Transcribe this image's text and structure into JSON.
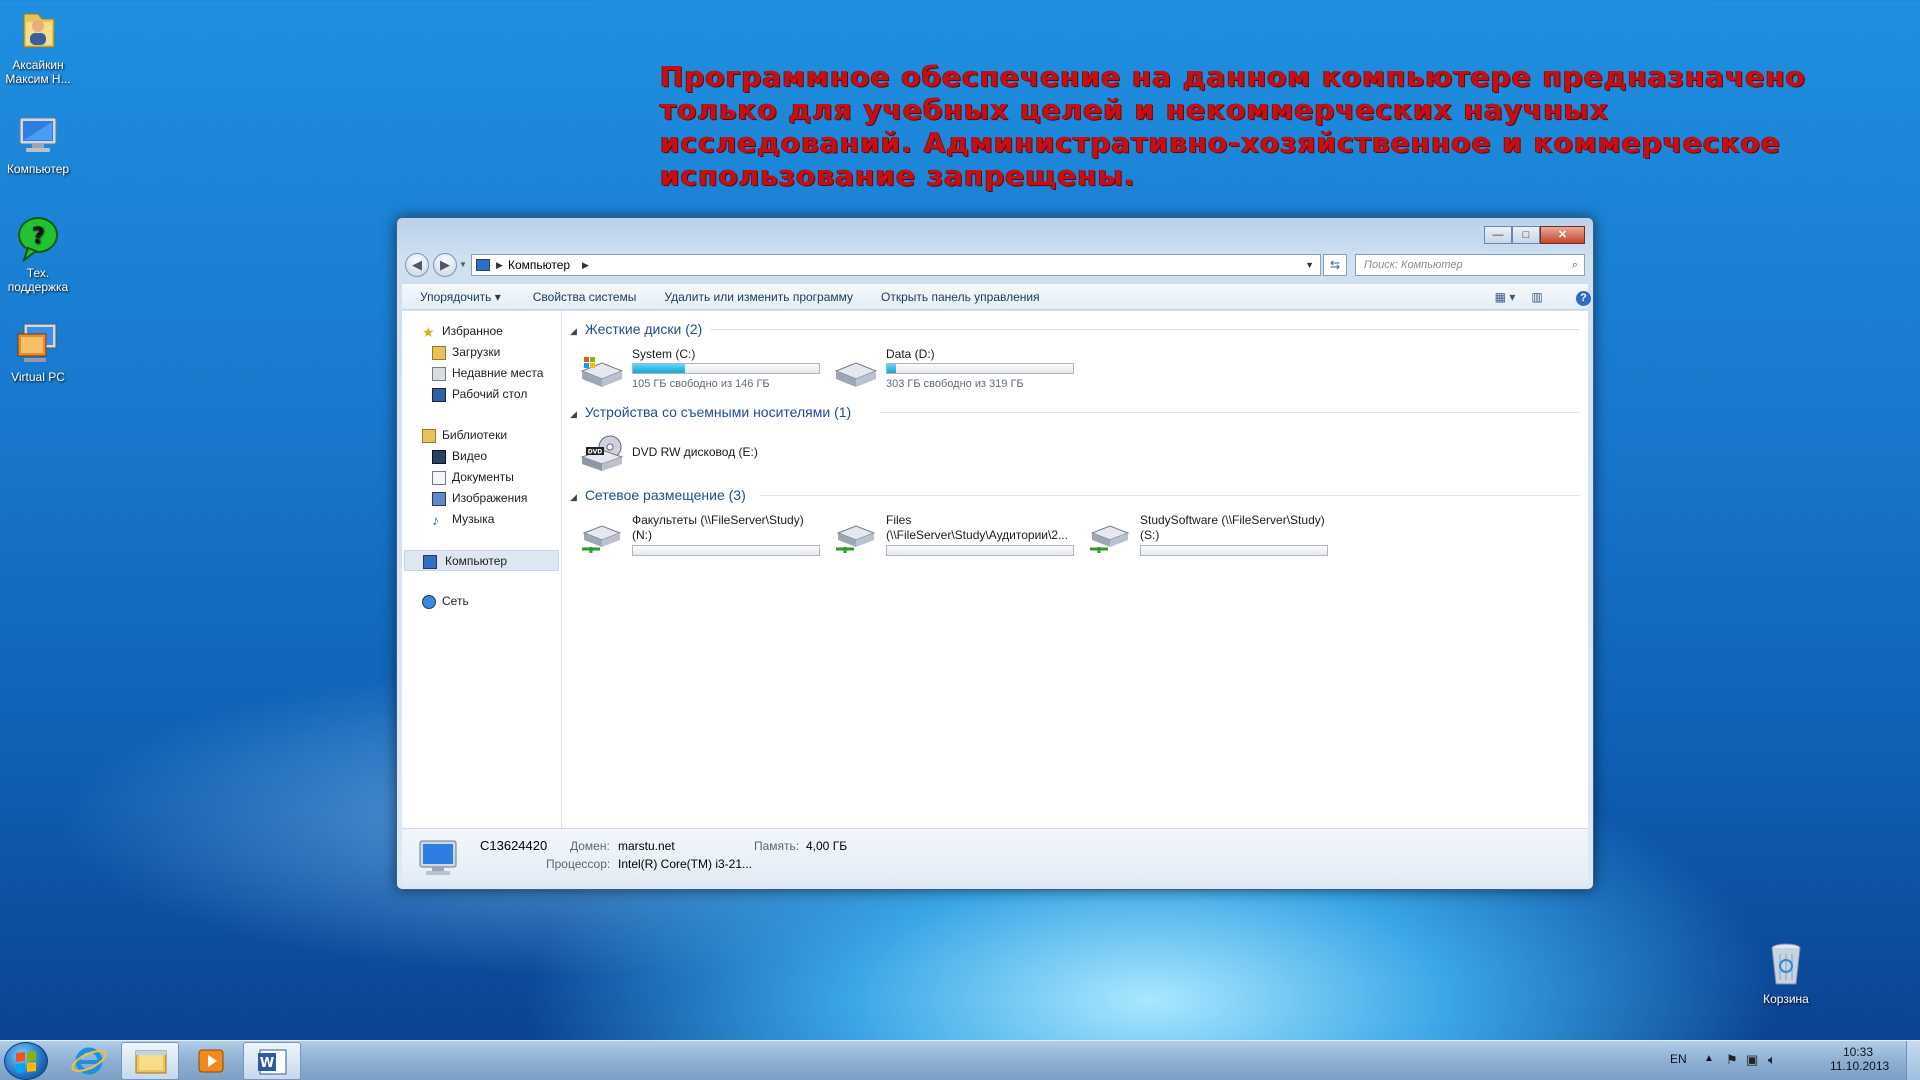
{
  "desktop": {
    "notice_lines": [
      "Программное обеспечение на данном компьютере предназначено",
      "только для учебных целей и некоммерческих научных",
      "исследований.  Административно-хозяйственное и коммерческое",
      "использование запрещены."
    ],
    "icons": [
      {
        "name": "user-folder-icon",
        "label_line1": "Аксайкин",
        "label_line2": "Максим Н..."
      },
      {
        "name": "computer-icon",
        "label_line1": "Компьютер",
        "label_line2": ""
      },
      {
        "name": "help-icon",
        "label_line1": "Тех.",
        "label_line2": "поддержка"
      },
      {
        "name": "virtual-pc-icon",
        "label_line1": "Virtual PC",
        "label_line2": ""
      },
      {
        "name": "recycle-bin-icon",
        "label_line1": "Корзина",
        "label_line2": ""
      }
    ]
  },
  "explorer": {
    "breadcrumb": "Компьютер",
    "search_placeholder": "Поиск: Компьютер",
    "window_buttons": {
      "minimize": "—",
      "maximize": "□",
      "close": "✕"
    },
    "toolbar": {
      "organize": "Упорядочить ▾",
      "system_properties": "Свойства системы",
      "uninstall": "Удалить или изменить программу",
      "control_panel": "Открыть панель управления"
    },
    "sidebar": {
      "favorites": "Избранное",
      "downloads": "Загрузки",
      "recent": "Недавние места",
      "desktop": "Рабочий стол",
      "libraries": "Библиотеки",
      "video": "Видео",
      "documents": "Документы",
      "images": "Изображения",
      "music": "Музыка",
      "computer": "Компьютер",
      "network": "Сеть"
    },
    "groups": {
      "hard_disks": "Жесткие диски (2)",
      "removable": "Устройства со съемными носителями (1)",
      "network": "Сетевое размещение (3)"
    },
    "drives": {
      "c_name": "System (C:)",
      "c_sub": "105 ГБ свободно из 146 ГБ",
      "c_used_fraction": 0.28,
      "d_name": "Data (D:)",
      "d_sub": "303 ГБ свободно из 319 ГБ",
      "d_used_fraction": 0.05,
      "e_name": "DVD RW дисковод (E:)",
      "n_line1": "Факультеты (\\\\FileServer\\Study)",
      "n_line2": "(N:)",
      "f_line1": "Files",
      "f_line2": "(\\\\FileServer\\Study\\Аудитории\\2...",
      "s_line1": "StudySoftware (\\\\FileServer\\Study)",
      "s_line2": "(S:)"
    },
    "details": {
      "computer_name": "C13624420",
      "domain_label": "Домен:",
      "domain_value": "marstu.net",
      "memory_label": "Память:",
      "memory_value": "4,00 ГБ",
      "cpu_label": "Процессор:",
      "cpu_value": "Intel(R) Core(TM) i3-21..."
    }
  },
  "taskbar": {
    "language": "EN",
    "time": "10:33",
    "date": "11.10.2013"
  }
}
